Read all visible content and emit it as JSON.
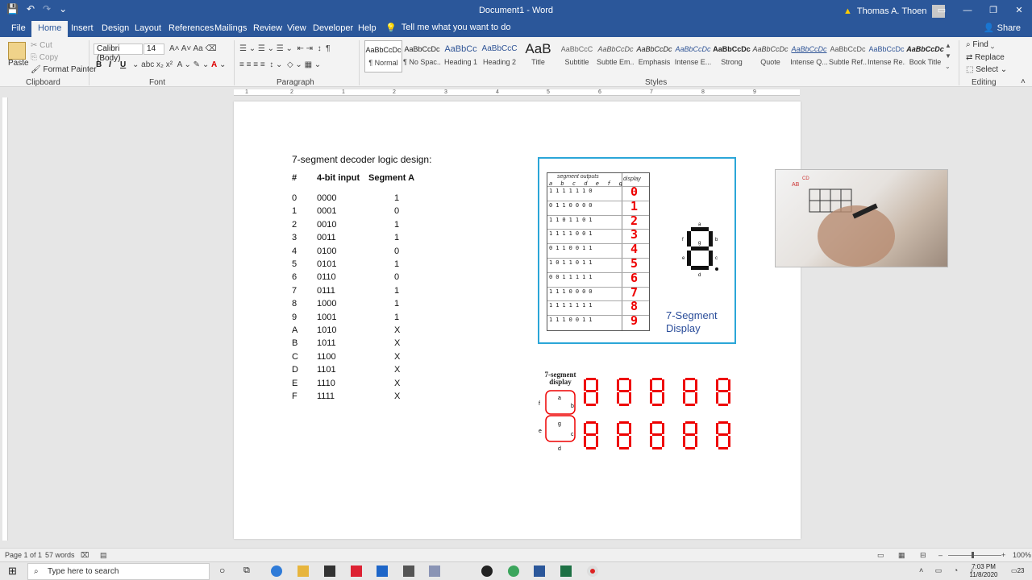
{
  "window": {
    "doc_title": "Document1 - Word",
    "user_name": "Thomas A. Thoen"
  },
  "tabs": [
    "File",
    "Home",
    "Insert",
    "Design",
    "Layout",
    "References",
    "Mailings",
    "Review",
    "View",
    "Developer",
    "Help"
  ],
  "active_tab": "Home",
  "tell_me": "Tell me what you want to do",
  "share": "Share",
  "ribbon": {
    "clipboard": {
      "paste": "Paste",
      "cut": "Cut",
      "copy": "Copy",
      "format_painter": "Format Painter",
      "label": "Clipboard"
    },
    "font": {
      "name": "Calibri (Body)",
      "size": "14",
      "label": "Font"
    },
    "paragraph": {
      "label": "Paragraph"
    },
    "styles": {
      "label": "Styles",
      "items": [
        {
          "preview": "AaBbCcDc",
          "name": "¶ Normal"
        },
        {
          "preview": "AaBbCcDc",
          "name": "¶ No Spac..."
        },
        {
          "preview": "AaBbCc",
          "name": "Heading 1"
        },
        {
          "preview": "AaBbCcC",
          "name": "Heading 2"
        },
        {
          "preview": "AaB",
          "name": "Title"
        },
        {
          "preview": "AaBbCcC",
          "name": "Subtitle"
        },
        {
          "preview": "AaBbCcDc",
          "name": "Subtle Em..."
        },
        {
          "preview": "AaBbCcDc",
          "name": "Emphasis"
        },
        {
          "preview": "AaBbCcDc",
          "name": "Intense E..."
        },
        {
          "preview": "AaBbCcDc",
          "name": "Strong"
        },
        {
          "preview": "AaBbCcDc",
          "name": "Quote"
        },
        {
          "preview": "AaBbCcDc",
          "name": "Intense Q..."
        },
        {
          "preview": "AaBbCcDc",
          "name": "Subtle Ref..."
        },
        {
          "preview": "AaBbCcDc",
          "name": "Intense Re..."
        },
        {
          "preview": "AaBbCcDc",
          "name": "Book Title"
        }
      ]
    },
    "editing": {
      "find": "Find",
      "replace": "Replace",
      "select": "Select",
      "label": "Editing"
    }
  },
  "ruler_numbers": [
    "1",
    "2",
    "1",
    "2",
    "3",
    "4",
    "5",
    "6",
    "7",
    "8",
    "9"
  ],
  "document": {
    "heading": "7-segment decoder logic design:",
    "columns": [
      "#",
      "4-bit input",
      "Segment A"
    ],
    "rows": [
      [
        "0",
        "0000",
        "1"
      ],
      [
        "1",
        "0001",
        "0"
      ],
      [
        "2",
        "0010",
        "1"
      ],
      [
        "3",
        "0011",
        "1"
      ],
      [
        "4",
        "0100",
        "0"
      ],
      [
        "5",
        "0101",
        "1"
      ],
      [
        "6",
        "0110",
        "0"
      ],
      [
        "7",
        "0111",
        "1"
      ],
      [
        "8",
        "1000",
        "1"
      ],
      [
        "9",
        "1001",
        "1"
      ],
      [
        "A",
        "1010",
        "X"
      ],
      [
        "B",
        "1011",
        "X"
      ],
      [
        "C",
        "1100",
        "X"
      ],
      [
        "D",
        "1101",
        "X"
      ],
      [
        "E",
        "1110",
        "X"
      ],
      [
        "F",
        "1111",
        "X"
      ]
    ]
  },
  "figure1": {
    "header_outputs": "segment outputs",
    "header_display": "display",
    "columns": [
      "a",
      "b",
      "c",
      "d",
      "e",
      "f",
      "g"
    ],
    "rows": [
      "1111110",
      "0110000",
      "1101101",
      "1111001",
      "0110011",
      "1011011",
      "0011111",
      "1110000",
      "1111111",
      "1110011"
    ],
    "digits": [
      "0",
      "1",
      "2",
      "3",
      "4",
      "5",
      "6",
      "7",
      "8",
      "9"
    ],
    "segment_labels": [
      "a",
      "b",
      "c",
      "d",
      "e",
      "f",
      "g"
    ],
    "caption_line1": "7-Segment",
    "caption_line2": "Display"
  },
  "figure2": {
    "label_line1": "7-segment",
    "label_line2": "display",
    "segment_labels": [
      "a",
      "b",
      "c",
      "d",
      "e",
      "f",
      "g"
    ]
  },
  "statusbar": {
    "page": "Page 1 of 1",
    "words": "57 words",
    "zoom": "100%"
  },
  "taskbar": {
    "search_placeholder": "Type here to search",
    "time": "7:03 PM",
    "date": "11/8/2020",
    "notif_count": "23"
  },
  "colors": {
    "word_blue": "#2b579a",
    "segment_red": "#e00000",
    "figure_border": "#2ba6d8",
    "caption_blue": "#2a4d9a"
  }
}
